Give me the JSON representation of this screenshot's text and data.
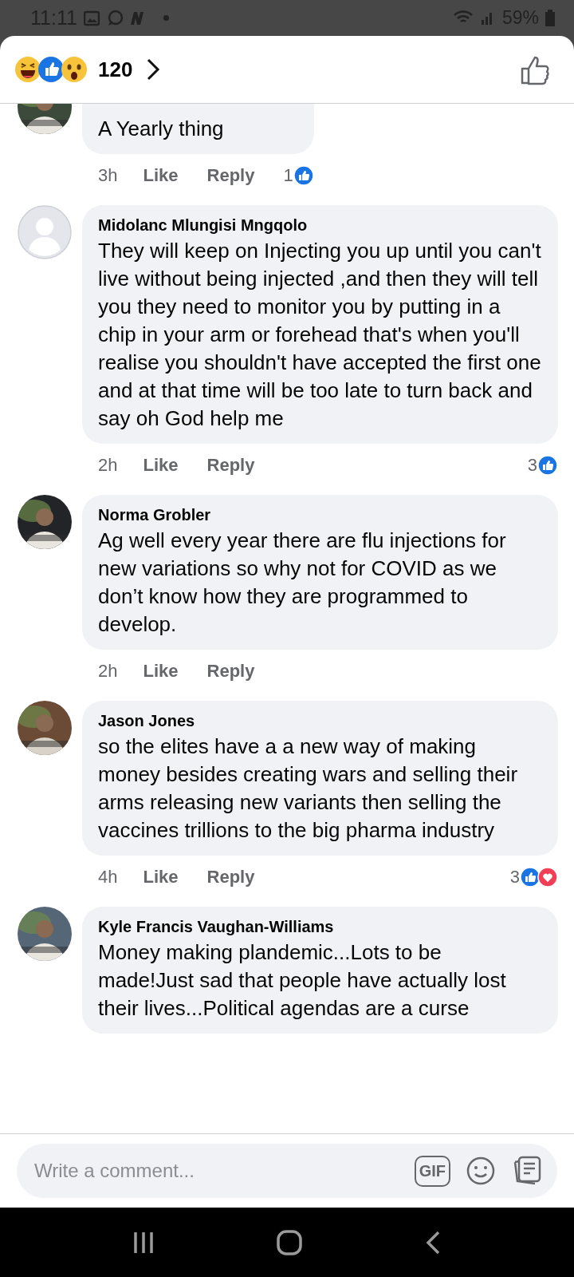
{
  "status_bar": {
    "time": "11:11",
    "battery": "59%"
  },
  "header": {
    "reactions": [
      {
        "kind": "haha"
      },
      {
        "kind": "like"
      },
      {
        "kind": "wow"
      }
    ],
    "count": "120"
  },
  "comments": [
    {
      "avatar": {
        "kind": "picture"
      },
      "text": "A Yearly thing",
      "time": "3h",
      "like": "Like",
      "reply": "Reply",
      "reaction_count": "1",
      "reactions": [
        {
          "kind": "like"
        }
      ]
    },
    {
      "avatar": {
        "kind": "default"
      },
      "name": "Midolanc Mlungisi Mngqolo",
      "text": "They will keep on Injecting you up until you can't live without being injected ,and then they will tell you they need to monitor you by putting in a chip in your arm or forehead that's when you'll realise you shouldn't have accepted the first one and at that time will be too late to turn back and say oh God help me",
      "time": "2h",
      "like": "Like",
      "reply": "Reply",
      "reaction_count": "3",
      "reactions": [
        {
          "kind": "like"
        }
      ]
    },
    {
      "avatar": {
        "kind": "picture"
      },
      "name": "Norma Grobler",
      "text": "Ag well every year there are flu injections for new variations so why not for COVID as we don’t know how they are programmed to develop.",
      "time": "2h",
      "like": "Like",
      "reply": "Reply"
    },
    {
      "avatar": {
        "kind": "picture"
      },
      "name": "Jason Jones",
      "text": "so the elites have a a new way of making money besides creating wars and selling their arms  releasing new variants then selling the vaccines trillions to the big pharma industry",
      "time": "4h",
      "like": "Like",
      "reply": "Reply",
      "reaction_count": "3",
      "reactions": [
        {
          "kind": "like"
        },
        {
          "kind": "love"
        }
      ]
    },
    {
      "avatar": {
        "kind": "picture"
      },
      "name": "Kyle Francis Vaughan-Williams",
      "text": "Money making  plandemic...Lots to be made!Just sad that people have  actually lost their lives...Political  agendas  are a curse"
    }
  ],
  "composer": {
    "placeholder": "Write a comment...",
    "gif": "GIF"
  }
}
